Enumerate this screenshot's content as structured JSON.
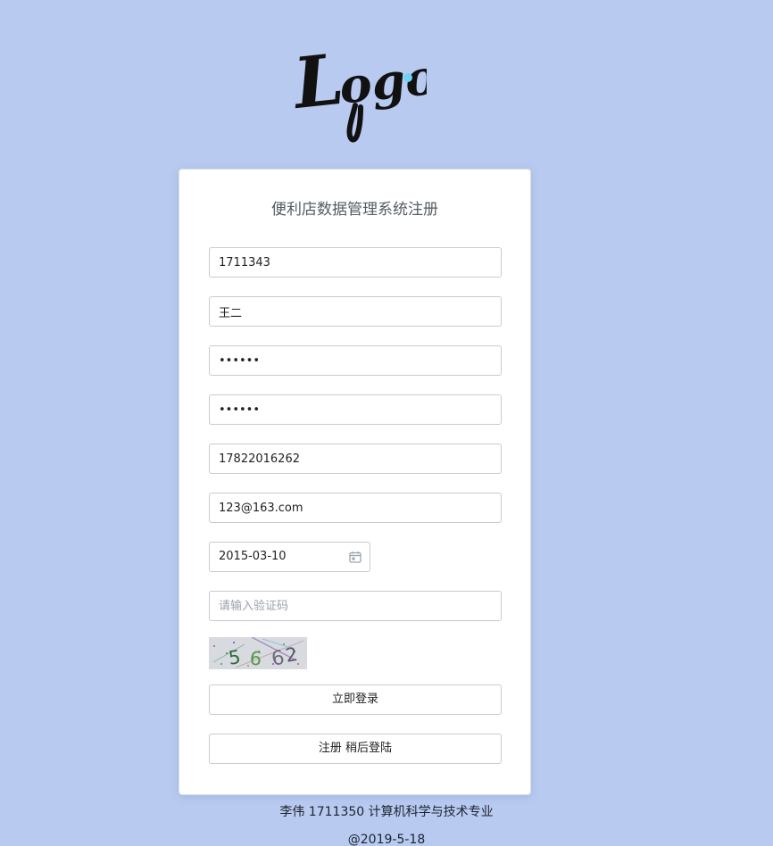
{
  "logo": {
    "text": "Logo"
  },
  "form": {
    "title": "便利店数据管理系统注册",
    "user_id": "1711343",
    "name": "王二",
    "password": "123456",
    "password_confirm": "123456",
    "phone": "17822016262",
    "email": "123@163.com",
    "date": "2015-03-10",
    "captcha_placeholder": "请输入验证码",
    "captcha_text": "5662",
    "login_button": "立即登录",
    "register_button": "注册 稍后登陆"
  },
  "footer": {
    "author": "李伟 1711350 计算机科学与技术专业",
    "date": "@2019-5-18"
  },
  "colors": {
    "background": "#b8caf0",
    "card": "#ffffff",
    "logo_dot": "#6fd3f7"
  }
}
